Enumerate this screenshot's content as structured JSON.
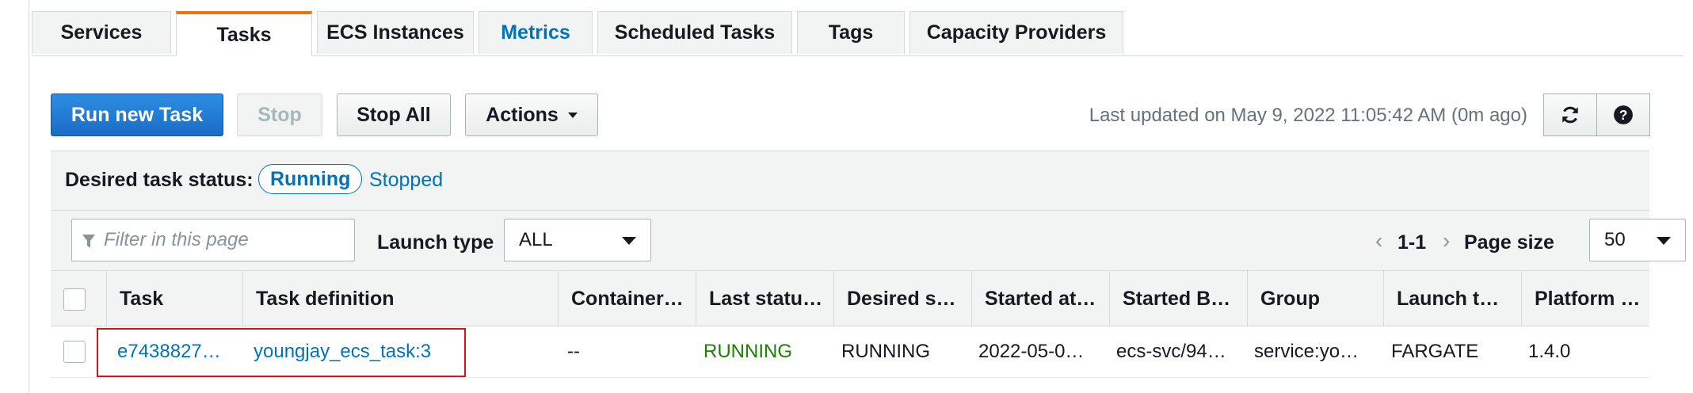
{
  "tabs": [
    {
      "label": "Services"
    },
    {
      "label": "Tasks"
    },
    {
      "label": "ECS Instances"
    },
    {
      "label": "Metrics"
    },
    {
      "label": "Scheduled Tasks"
    },
    {
      "label": "Tags"
    },
    {
      "label": "Capacity Providers"
    }
  ],
  "active_tab": "Tasks",
  "toolbar": {
    "run_new_task": "Run new Task",
    "stop": "Stop",
    "stop_all": "Stop All",
    "actions": "Actions",
    "last_updated": "Last updated on May 9, 2022 11:05:42 AM (0m ago)"
  },
  "status_filter": {
    "label": "Desired task status:",
    "running": "Running",
    "stopped": "Stopped"
  },
  "filters": {
    "search_placeholder": "Filter in this page",
    "launch_type_label": "Launch type",
    "launch_type_value": "ALL",
    "range": "1-1",
    "page_size_label": "Page size",
    "page_size_value": "50"
  },
  "table": {
    "columns": [
      "Task",
      "Task definition",
      "Container…",
      "Last statu…",
      "Desired s…",
      "Started at…",
      "Started B…",
      "Group",
      "Launch t…",
      "Platform …"
    ],
    "rows": [
      {
        "task": "e7438827…",
        "task_definition": "youngjay_ecs_task:3",
        "container": "--",
        "last_status": "RUNNING",
        "desired_status": "RUNNING",
        "started_at": "2022-05-0…",
        "started_by": "ecs-svc/94…",
        "group": "service:yo…",
        "launch_type": "FARGATE",
        "platform": "1.4.0"
      }
    ]
  },
  "colors": {
    "accent_orange": "#ec7211",
    "link_blue": "#0073bb",
    "primary_button": "#1a6cc7",
    "running_green": "#1d8102",
    "highlight_red": "#d9121b"
  }
}
